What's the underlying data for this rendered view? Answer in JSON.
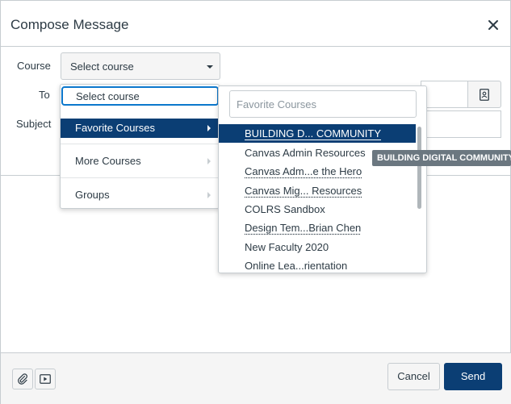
{
  "dialog": {
    "title": "Compose Message",
    "close_icon": "close-icon"
  },
  "form": {
    "course_label": "Course",
    "course_select_value": "Select course",
    "to_label": "To",
    "subject_label": "Subject",
    "address_book_icon": "address-book-icon"
  },
  "course_menu": {
    "select_course": "Select course",
    "items": [
      {
        "label": "Favorite Courses",
        "active": true
      },
      {
        "label": "More Courses",
        "active": false
      },
      {
        "label": "Groups",
        "active": false
      }
    ]
  },
  "favorites_menu": {
    "search_placeholder": "Favorite Courses",
    "courses": [
      {
        "label": "BUILDING D... COMMUNITY",
        "active": true
      },
      {
        "label": "Canvas Admin Resources",
        "active": false
      },
      {
        "label": "Canvas Adm...e the Hero",
        "active": false
      },
      {
        "label": "Canvas Mig... Resources",
        "active": false
      },
      {
        "label": "COLRS Sandbox",
        "active": false
      },
      {
        "label": "Design Tem...Brian Chen",
        "active": false
      },
      {
        "label": "New Faculty 2020",
        "active": false
      },
      {
        "label": "Online Lea...rientation",
        "active": false
      }
    ]
  },
  "tooltip": {
    "text": "BUILDING DIGITAL COMMUNITY"
  },
  "footer": {
    "attach_icon": "paperclip-icon",
    "media_icon": "media-icon",
    "cancel_label": "Cancel",
    "send_label": "Send"
  },
  "colors": {
    "primary": "#0b3e74",
    "focus": "#0b77cc",
    "border": "#c7cdd1",
    "text": "#2d3b45",
    "tooltip_bg": "#6b7780"
  }
}
